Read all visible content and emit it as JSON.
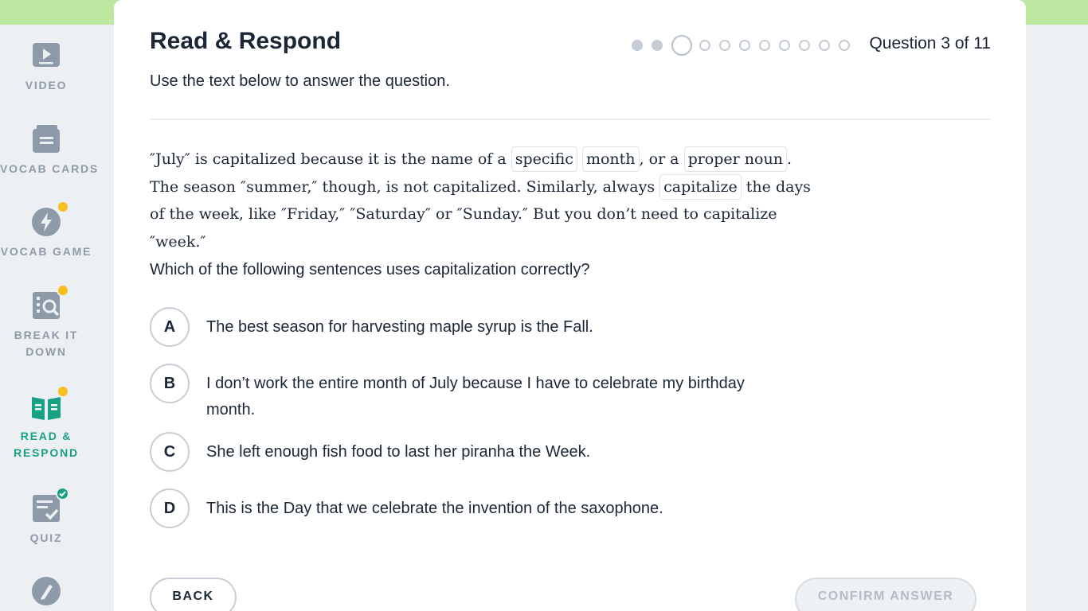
{
  "sidebar": {
    "items": [
      {
        "label": "VIDEO",
        "icon": "video-icon",
        "badge": "none"
      },
      {
        "label": "VOCAB CARDS",
        "icon": "vocab-cards-icon",
        "badge": "none"
      },
      {
        "label": "VOCAB GAME",
        "icon": "lightning-icon",
        "badge": "new"
      },
      {
        "label_line1": "BREAK IT",
        "label_line2": "DOWN",
        "icon": "magnify-doc-icon",
        "badge": "new"
      },
      {
        "label_line1": "READ &",
        "label_line2": "RESPOND",
        "icon": "open-book-icon",
        "badge": "new",
        "active": true
      },
      {
        "label": "QUIZ",
        "icon": "quiz-checklist-icon",
        "badge": "complete"
      },
      {
        "label": "",
        "icon": "music-pencil-icon",
        "badge": "none"
      }
    ]
  },
  "header": {
    "title": "Read & Respond",
    "subtitle": "Use the text below to answer the question.",
    "counter": "Question 3 of 11",
    "progress": {
      "current": 3,
      "total": 11
    }
  },
  "passage": {
    "t1": "″July″ is capitalized because it is the name of a",
    "v1": "specific",
    "v2": "month",
    "t2": ", or a",
    "v3": "proper noun",
    "t3": ". The season ″summer,″ though, is not capitalized. Similarly, always",
    "v4": "capitalize",
    "t4": "the days of the week, like ″Friday,″ ″Saturday″ or ″Sunday.″ But you don’t need to capitalize ″week.″"
  },
  "question": "Which of the following sentences uses capitalization correctly?",
  "choices": [
    {
      "letter": "A",
      "text": "The best season for harvesting maple syrup is the Fall."
    },
    {
      "letter": "B",
      "text": "I don’t work the entire month of July because I have to celebrate my birthday month."
    },
    {
      "letter": "C",
      "text": "She left enough fish food to last her piranha the Week."
    },
    {
      "letter": "D",
      "text": "This is the Day that we celebrate the invention of the saxophone."
    }
  ],
  "buttons": {
    "back": "BACK",
    "confirm": "CONFIRM ANSWER"
  },
  "colors": {
    "accent": "#18a085",
    "badge": "#f8bd1e",
    "band": "#bde8a2",
    "muted": "#8e9aa8"
  }
}
